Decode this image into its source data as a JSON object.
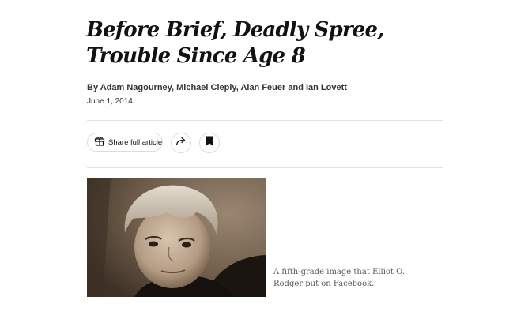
{
  "article": {
    "headline": "Before Brief, Deadly Spree, Trouble Since Age 8",
    "byline": {
      "prefix": "By",
      "authors": [
        "Adam Nagourney",
        "Michael Cieply",
        "Alan Feuer",
        "Ian Lovett"
      ],
      "separator": ",",
      "conjunction": "and"
    },
    "date": "June 1, 2014"
  },
  "toolbar": {
    "share_label": "Share full article",
    "share_icon": "gift-icon",
    "forward_icon": "share-arrow-icon",
    "save_icon": "bookmark-icon"
  },
  "figure": {
    "image_alt": "Photograph of a young boy",
    "caption": "A fifth-grade image that Elliot O. Rodger put on Facebook."
  },
  "colors": {
    "text": "#121212",
    "rule": "#e2e2e2",
    "caption": "#5a5a5a"
  }
}
